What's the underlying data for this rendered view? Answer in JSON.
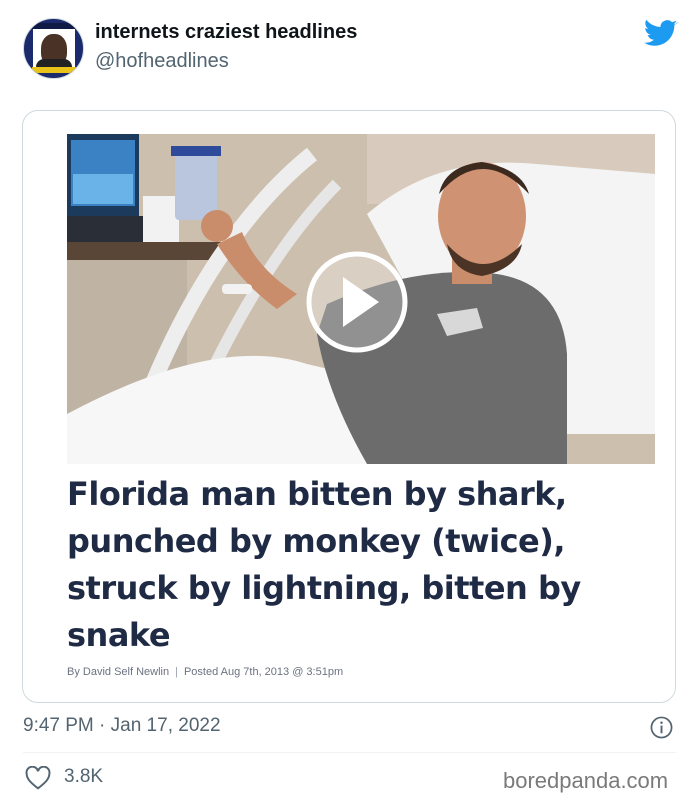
{
  "tweet": {
    "display_name": "internets craziest headlines",
    "handle": "@hofheadlines",
    "timestamp": "9:47 PM · Jan 17, 2022",
    "like_count": "3.8K"
  },
  "article": {
    "headline": "Florida man bitten by shark, punched by monkey (twice), struck by lightning, bitten by snake",
    "byline_author": "By David Self Newlin",
    "byline_posted": "Posted Aug 7th, 2013 @ 3:51pm"
  },
  "watermark": "boredpanda.com",
  "icons": {
    "brand": "twitter-bird-icon",
    "play": "play-icon",
    "info": "info-icon",
    "like": "heart-icon"
  },
  "colors": {
    "twitter_blue": "#1d9bf0",
    "headline": "#1f2a44",
    "muted": "#536471"
  }
}
